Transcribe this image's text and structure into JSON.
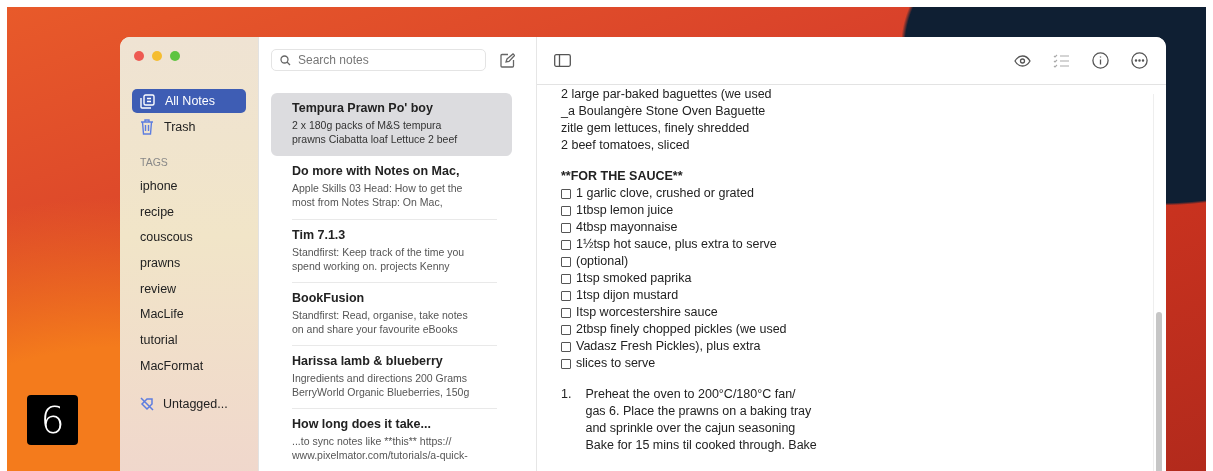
{
  "sidebar": {
    "items": [
      {
        "label": "All Notes",
        "kind": "notes",
        "selected": true
      },
      {
        "label": "Trash",
        "kind": "trash",
        "selected": false
      }
    ],
    "tags_heading": "TAGS",
    "tags": [
      "iphone",
      "recipe",
      "couscous",
      "prawns",
      "review",
      "MacLife",
      "tutorial",
      "MacFormat"
    ],
    "untagged": "Untagged..."
  },
  "note_list": {
    "search": {
      "placeholder": "Search notes"
    },
    "notes": [
      {
        "title": "Tempura Prawn Po' boy",
        "snippet": [
          "2 x 180g packs of M&S tempura",
          "prawns Ciabatta loaf Lettuce 2 beef"
        ],
        "selected": true
      },
      {
        "title": "Do more with Notes on Mac,",
        "snippet": [
          "Apple Skills 03 Head: How to get the",
          "most from Notes Strap: On Mac,"
        ],
        "selected": false
      },
      {
        "title": "Tim 7.1.3",
        "snippet": [
          "Standfirst: Keep track of the time you",
          "spend working on. projects Kenny"
        ],
        "selected": false
      },
      {
        "title": "BookFusion",
        "snippet": [
          "Standfirst: Read, organise, take notes",
          "on and share your favourite eBooks"
        ],
        "selected": false
      },
      {
        "title": "Harissa lamb & blueberry",
        "snippet": [
          "Ingredients and directions 200 Grams",
          "BerryWorld Organic Blueberries, 150g"
        ],
        "selected": false
      },
      {
        "title": "How long does it take...",
        "snippet": [
          "...to sync notes like **this** https://",
          "www.pixelmator.com/tutorials/a-quick-"
        ],
        "selected": false
      }
    ]
  },
  "editor": {
    "blocks": [
      {
        "kind": "text",
        "lines": [
          "2 large par-baked baguettes (we used",
          "_a Boulangère Stone Oven Baguette",
          "zitle gem lettuces, finely shredded",
          "2 beef tomatoes, sliced"
        ]
      },
      {
        "kind": "heading",
        "text": "**FOR THE SAUCE**"
      },
      {
        "kind": "checklist",
        "items": [
          {
            "text": "1 garlic clove, crushed or grated",
            "checked": false
          },
          {
            "text": "1tbsp lemon juice",
            "checked": false
          },
          {
            "text": "4tbsp mayonnaise",
            "checked": false
          },
          {
            "text": "1½tsp hot sauce, plus extra to serve",
            "checked": false
          },
          {
            "text": "(optional)",
            "checked": false
          },
          {
            "text": "1tsp smoked paprika",
            "checked": false
          },
          {
            "text": "1tsp dijon mustard",
            "checked": false
          },
          {
            "text": "Itsp worcestershire sauce",
            "checked": false
          },
          {
            "text": "2tbsp finely chopped pickles (we used",
            "checked": false
          },
          {
            "text": "Vadasz Fresh Pickles), plus extra",
            "checked": false
          },
          {
            "text": "slices to serve",
            "checked": false
          }
        ]
      },
      {
        "kind": "numbered",
        "number": "1.",
        "lines": [
          "Preheat the oven to 200°C/180°C fan/",
          "gas 6. Place the prawns on a baking tray",
          "and sprinkle over the cajun seasoning",
          "Bake for 15 mins til cooked through. Bake"
        ]
      }
    ]
  },
  "figure_number": "6"
}
